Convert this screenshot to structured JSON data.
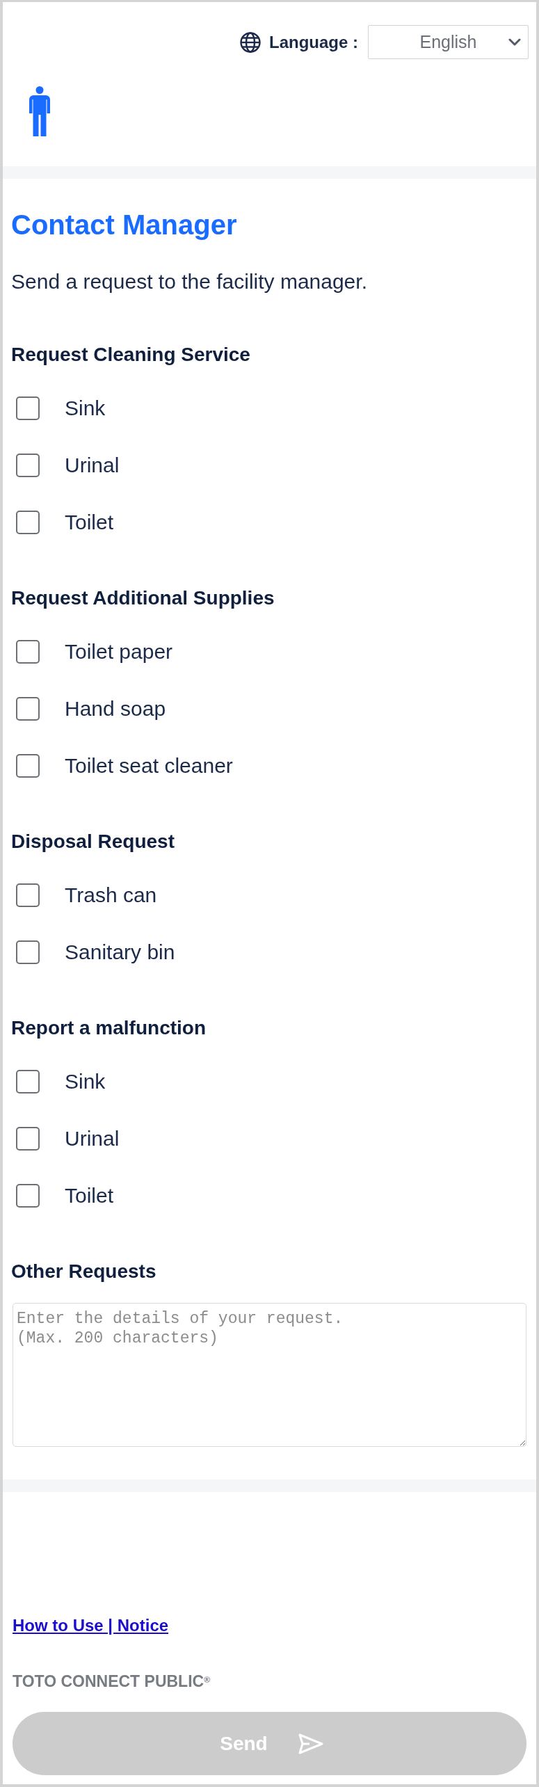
{
  "header": {
    "language": {
      "label": "Language :",
      "value": "English"
    }
  },
  "page": {
    "title": "Contact Manager",
    "description": "Send a request to the facility manager."
  },
  "sections": [
    {
      "heading": "Request Cleaning Service",
      "options": [
        {
          "label": "Sink",
          "checked": false
        },
        {
          "label": "Urinal",
          "checked": false
        },
        {
          "label": "Toilet",
          "checked": false
        }
      ]
    },
    {
      "heading": "Request Additional Supplies",
      "options": [
        {
          "label": "Toilet paper",
          "checked": false
        },
        {
          "label": "Hand soap",
          "checked": false
        },
        {
          "label": "Toilet seat cleaner",
          "checked": false
        }
      ]
    },
    {
      "heading": "Disposal Request",
      "options": [
        {
          "label": "Trash can",
          "checked": false
        },
        {
          "label": "Sanitary bin",
          "checked": false
        }
      ]
    },
    {
      "heading": "Report a malfunction",
      "options": [
        {
          "label": "Sink",
          "checked": false
        },
        {
          "label": "Urinal",
          "checked": false
        },
        {
          "label": "Toilet",
          "checked": false
        }
      ]
    }
  ],
  "other_requests": {
    "heading": "Other Requests",
    "placeholder": "Enter the details of your request.\n(Max. 200 characters)"
  },
  "footer": {
    "link": "How to Use | Notice",
    "brand": "TOTO CONNECT PUBLIC$^{®}$",
    "send_button": {
      "label": "Send",
      "disabled": true
    }
  }
}
